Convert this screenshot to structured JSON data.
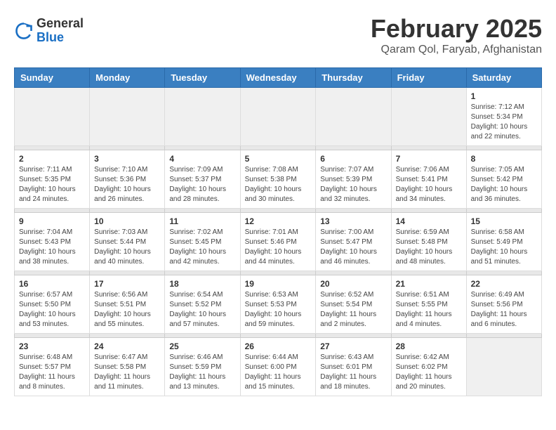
{
  "header": {
    "logo_general": "General",
    "logo_blue": "Blue",
    "title": "February 2025",
    "subtitle": "Qaram Qol, Faryab, Afghanistan"
  },
  "days_of_week": [
    "Sunday",
    "Monday",
    "Tuesday",
    "Wednesday",
    "Thursday",
    "Friday",
    "Saturday"
  ],
  "weeks": [
    {
      "days": [
        {
          "num": "",
          "info": "",
          "empty": true
        },
        {
          "num": "",
          "info": "",
          "empty": true
        },
        {
          "num": "",
          "info": "",
          "empty": true
        },
        {
          "num": "",
          "info": "",
          "empty": true
        },
        {
          "num": "",
          "info": "",
          "empty": true
        },
        {
          "num": "",
          "info": "",
          "empty": true
        },
        {
          "num": "1",
          "info": "Sunrise: 7:12 AM\nSunset: 5:34 PM\nDaylight: 10 hours\nand 22 minutes."
        }
      ]
    },
    {
      "days": [
        {
          "num": "2",
          "info": "Sunrise: 7:11 AM\nSunset: 5:35 PM\nDaylight: 10 hours\nand 24 minutes."
        },
        {
          "num": "3",
          "info": "Sunrise: 7:10 AM\nSunset: 5:36 PM\nDaylight: 10 hours\nand 26 minutes."
        },
        {
          "num": "4",
          "info": "Sunrise: 7:09 AM\nSunset: 5:37 PM\nDaylight: 10 hours\nand 28 minutes."
        },
        {
          "num": "5",
          "info": "Sunrise: 7:08 AM\nSunset: 5:38 PM\nDaylight: 10 hours\nand 30 minutes."
        },
        {
          "num": "6",
          "info": "Sunrise: 7:07 AM\nSunset: 5:39 PM\nDaylight: 10 hours\nand 32 minutes."
        },
        {
          "num": "7",
          "info": "Sunrise: 7:06 AM\nSunset: 5:41 PM\nDaylight: 10 hours\nand 34 minutes."
        },
        {
          "num": "8",
          "info": "Sunrise: 7:05 AM\nSunset: 5:42 PM\nDaylight: 10 hours\nand 36 minutes."
        }
      ]
    },
    {
      "days": [
        {
          "num": "9",
          "info": "Sunrise: 7:04 AM\nSunset: 5:43 PM\nDaylight: 10 hours\nand 38 minutes."
        },
        {
          "num": "10",
          "info": "Sunrise: 7:03 AM\nSunset: 5:44 PM\nDaylight: 10 hours\nand 40 minutes."
        },
        {
          "num": "11",
          "info": "Sunrise: 7:02 AM\nSunset: 5:45 PM\nDaylight: 10 hours\nand 42 minutes."
        },
        {
          "num": "12",
          "info": "Sunrise: 7:01 AM\nSunset: 5:46 PM\nDaylight: 10 hours\nand 44 minutes."
        },
        {
          "num": "13",
          "info": "Sunrise: 7:00 AM\nSunset: 5:47 PM\nDaylight: 10 hours\nand 46 minutes."
        },
        {
          "num": "14",
          "info": "Sunrise: 6:59 AM\nSunset: 5:48 PM\nDaylight: 10 hours\nand 48 minutes."
        },
        {
          "num": "15",
          "info": "Sunrise: 6:58 AM\nSunset: 5:49 PM\nDaylight: 10 hours\nand 51 minutes."
        }
      ]
    },
    {
      "days": [
        {
          "num": "16",
          "info": "Sunrise: 6:57 AM\nSunset: 5:50 PM\nDaylight: 10 hours\nand 53 minutes."
        },
        {
          "num": "17",
          "info": "Sunrise: 6:56 AM\nSunset: 5:51 PM\nDaylight: 10 hours\nand 55 minutes."
        },
        {
          "num": "18",
          "info": "Sunrise: 6:54 AM\nSunset: 5:52 PM\nDaylight: 10 hours\nand 57 minutes."
        },
        {
          "num": "19",
          "info": "Sunrise: 6:53 AM\nSunset: 5:53 PM\nDaylight: 10 hours\nand 59 minutes."
        },
        {
          "num": "20",
          "info": "Sunrise: 6:52 AM\nSunset: 5:54 PM\nDaylight: 11 hours\nand 2 minutes."
        },
        {
          "num": "21",
          "info": "Sunrise: 6:51 AM\nSunset: 5:55 PM\nDaylight: 11 hours\nand 4 minutes."
        },
        {
          "num": "22",
          "info": "Sunrise: 6:49 AM\nSunset: 5:56 PM\nDaylight: 11 hours\nand 6 minutes."
        }
      ]
    },
    {
      "days": [
        {
          "num": "23",
          "info": "Sunrise: 6:48 AM\nSunset: 5:57 PM\nDaylight: 11 hours\nand 8 minutes."
        },
        {
          "num": "24",
          "info": "Sunrise: 6:47 AM\nSunset: 5:58 PM\nDaylight: 11 hours\nand 11 minutes."
        },
        {
          "num": "25",
          "info": "Sunrise: 6:46 AM\nSunset: 5:59 PM\nDaylight: 11 hours\nand 13 minutes."
        },
        {
          "num": "26",
          "info": "Sunrise: 6:44 AM\nSunset: 6:00 PM\nDaylight: 11 hours\nand 15 minutes."
        },
        {
          "num": "27",
          "info": "Sunrise: 6:43 AM\nSunset: 6:01 PM\nDaylight: 11 hours\nand 18 minutes."
        },
        {
          "num": "28",
          "info": "Sunrise: 6:42 AM\nSunset: 6:02 PM\nDaylight: 11 hours\nand 20 minutes."
        },
        {
          "num": "",
          "info": "",
          "empty": true
        }
      ]
    }
  ]
}
